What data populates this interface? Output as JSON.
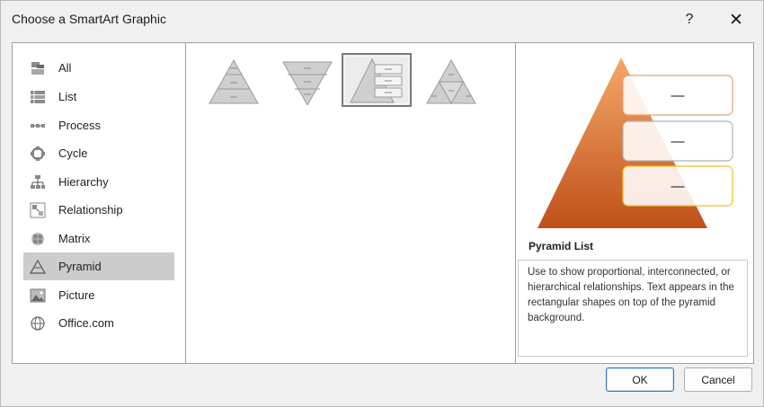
{
  "window": {
    "title": "Choose a SmartArt Graphic",
    "help_label": "?",
    "close_label": "✕"
  },
  "categories": [
    {
      "label": "All",
      "icon": "all-icon"
    },
    {
      "label": "List",
      "icon": "list-icon"
    },
    {
      "label": "Process",
      "icon": "process-icon"
    },
    {
      "label": "Cycle",
      "icon": "cycle-icon"
    },
    {
      "label": "Hierarchy",
      "icon": "hierarchy-icon"
    },
    {
      "label": "Relationship",
      "icon": "relationship-icon"
    },
    {
      "label": "Matrix",
      "icon": "matrix-icon"
    },
    {
      "label": "Pyramid",
      "icon": "pyramid-icon",
      "selected": true
    },
    {
      "label": "Picture",
      "icon": "picture-icon"
    },
    {
      "label": "Office.com",
      "icon": "globe-icon"
    }
  ],
  "gallery": {
    "items": [
      {
        "name": "basic-pyramid",
        "selected": false
      },
      {
        "name": "inverted-pyramid",
        "selected": false
      },
      {
        "name": "pyramid-list",
        "selected": true
      },
      {
        "name": "segmented-pyramid",
        "selected": false
      }
    ]
  },
  "preview": {
    "title": "Pyramid List",
    "description": "Use to show proportional, interconnected, or hierarchical relationships. Text appears in the rectangular shapes on top of the pyramid background.",
    "box_labels": [
      "—",
      "—",
      "—"
    ]
  },
  "buttons": {
    "ok_label": "OK",
    "cancel_label": "Cancel"
  },
  "colors": {
    "selected_category_bg": "#cccccc",
    "pyramid_top": "#f0a060",
    "pyramid_bottom": "#c0501a",
    "ok_border": "#2b73c9"
  }
}
